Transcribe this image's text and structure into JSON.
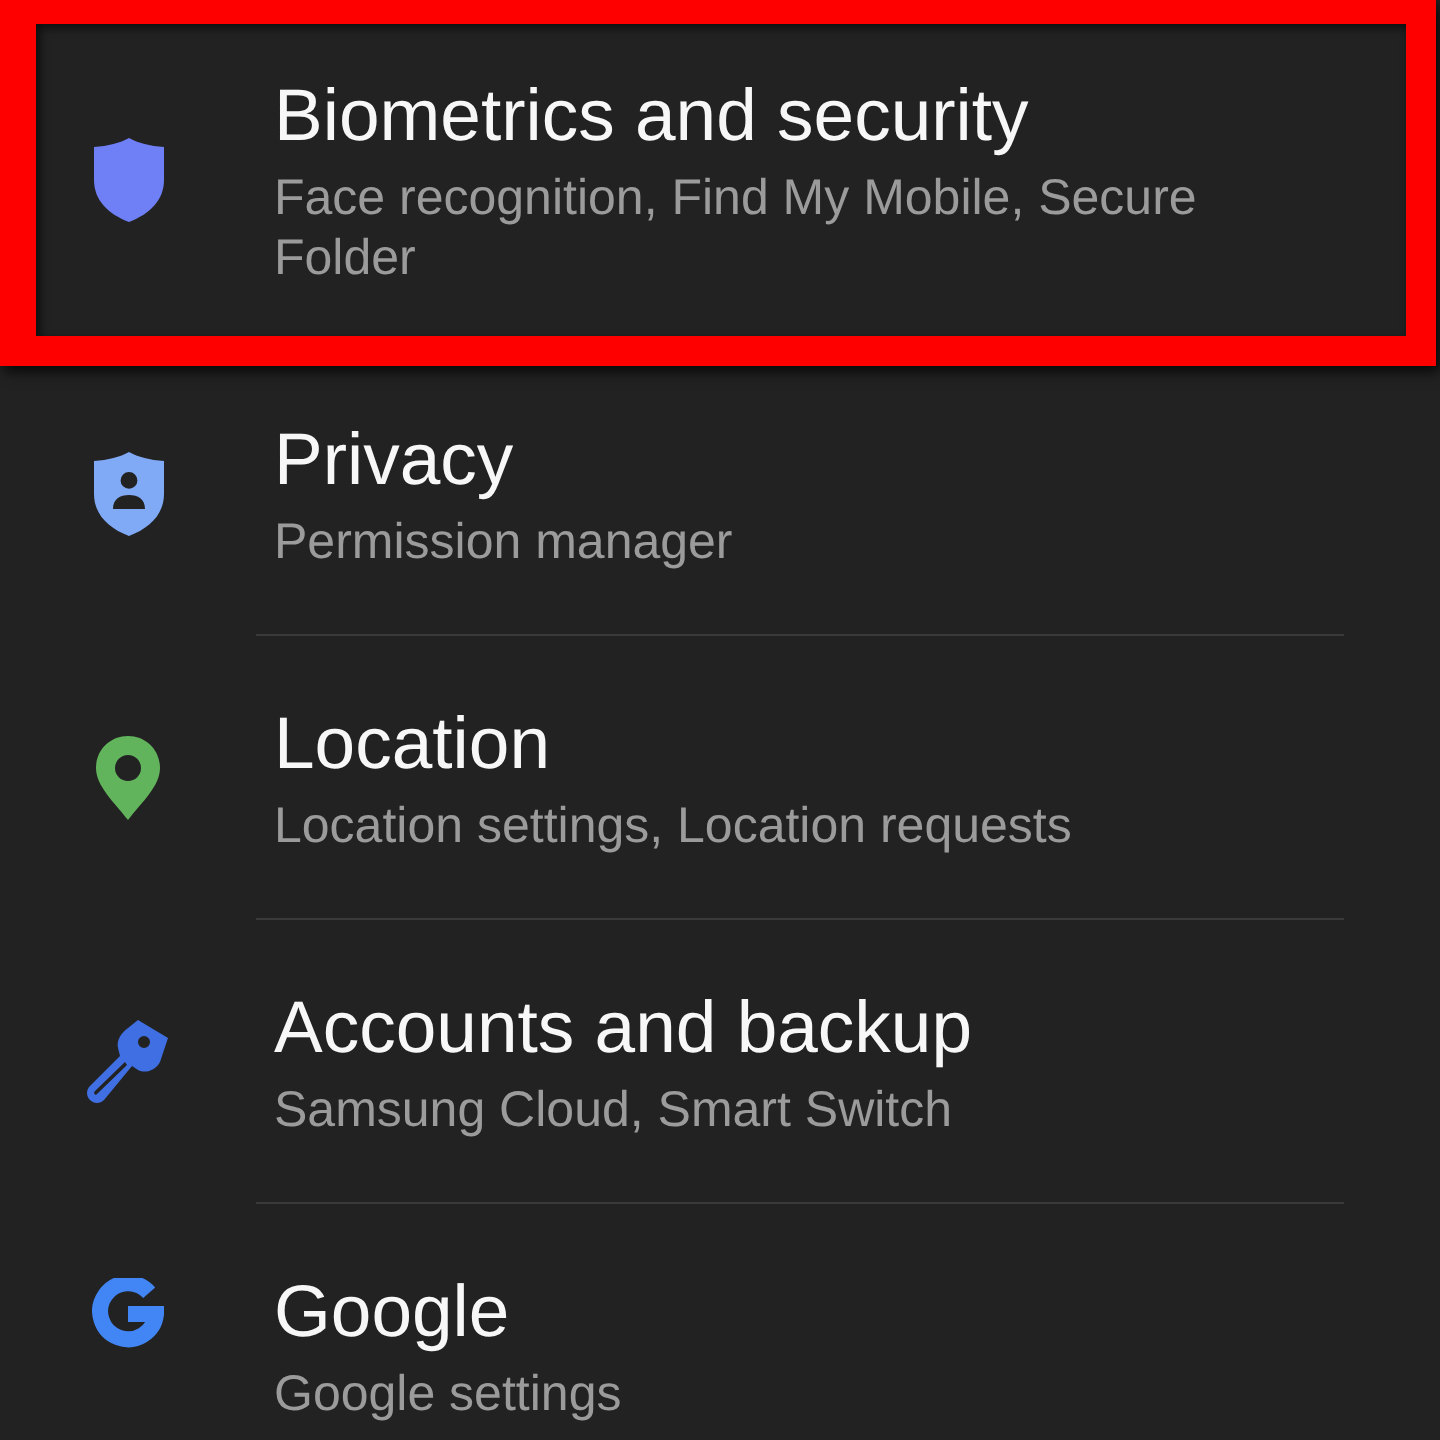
{
  "items": [
    {
      "kind": "biometrics",
      "title": "Biometrics and security",
      "subtitle": "Face recognition, Find My Mobile, Secure Folder",
      "highlighted": true
    },
    {
      "kind": "privacy",
      "title": "Privacy",
      "subtitle": "Permission manager",
      "highlighted": false
    },
    {
      "kind": "location",
      "title": "Location",
      "subtitle": "Location settings, Location requests",
      "highlighted": false
    },
    {
      "kind": "accounts",
      "title": "Accounts and backup",
      "subtitle": "Samsung Cloud, Smart Switch",
      "highlighted": false
    },
    {
      "kind": "google",
      "title": "Google",
      "subtitle": "Google settings",
      "highlighted": false
    }
  ]
}
